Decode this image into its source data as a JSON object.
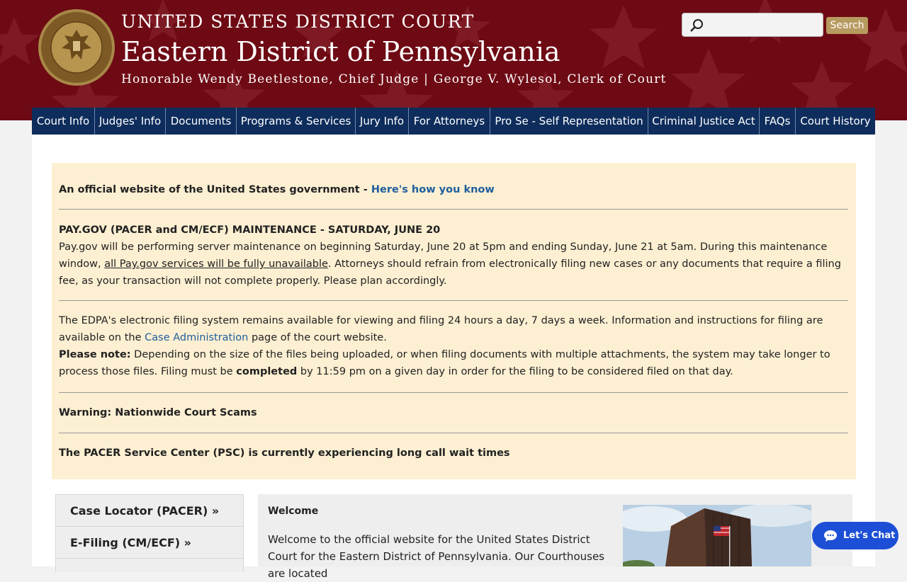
{
  "header": {
    "court_name": "UNITED STATES DISTRICT COURT",
    "district": "Eastern District of Pennsylvania",
    "officials": "Honorable Wendy Beetlestone, Chief Judge | George V. Wylesol, Clerk of Court",
    "seal_icon": "court-seal-icon",
    "bg_color": "#6e0a14"
  },
  "search": {
    "placeholder": "",
    "value": "",
    "button_label": "Search",
    "button_color": "#b79a60"
  },
  "nav": {
    "color": "#0e2d5c",
    "items": [
      {
        "label": "Court Info"
      },
      {
        "label": "Judges' Info"
      },
      {
        "label": "Documents"
      },
      {
        "label": "Programs & Services"
      },
      {
        "label": "Jury Info"
      },
      {
        "label": "For Attorneys"
      },
      {
        "label": "Pro Se - Self Representation"
      },
      {
        "label": "Criminal Justice Act"
      },
      {
        "label": "FAQs"
      },
      {
        "label": "Court History"
      }
    ]
  },
  "alert": {
    "bg_color": "#fdefd2",
    "official_text": "An official website of the United States government - ",
    "official_link": "Here's how you know",
    "paygov_title": "PAY.GOV (PACER and CM/ECF) MAINTENANCE - SATURDAY, JUNE 20",
    "paygov_text_1": "Pay.gov will be performing server maintenance on beginning Saturday, June 20 at 5pm and ending Sunday, June 21 at 5am. During this maintenance window, ",
    "paygov_text_u": "all Pay.gov services will be fully unavailable",
    "paygov_text_2": ". Attorneys should refrain from electronically filing new cases or any documents that require a filing fee, as your transaction will not complete properly. Please plan accordingly.",
    "efiling_text_1": "The EDPA's electronic filing system remains available for viewing and filing 24 hours a day, 7 days a week. Information and instructions for filing are available on the ",
    "efiling_link": "Case Administration",
    "efiling_text_2": " page of the court website.",
    "note_label": "Please note:",
    "note_text_1": " Depending on the size of the files being uploaded, or when filing documents with multiple attachments, the system may take longer to process those files. Filing must be ",
    "note_bold": "completed",
    "note_text_2": " by 11:59 pm on a given day in order for the filing to be considered filed on that day.",
    "warning_link": "Warning: Nationwide Court Scams",
    "pacer_link": "The PACER Service Center (PSC) is currently experiencing long call wait times",
    "link_color": "#1f5e9c"
  },
  "sidebar": {
    "items": [
      {
        "label": "Case Locator (PACER) »"
      },
      {
        "label": "E-Filing (CM/ECF) »"
      }
    ]
  },
  "welcome": {
    "title": "Welcome",
    "text": "Welcome to the official website for the United States District Court for the Eastern District of Pennsylvania. Our Courthouses are located"
  },
  "chat": {
    "label": "Let's Chat",
    "icon": "chat-bubble-icon",
    "color": "#1d4fd6"
  }
}
